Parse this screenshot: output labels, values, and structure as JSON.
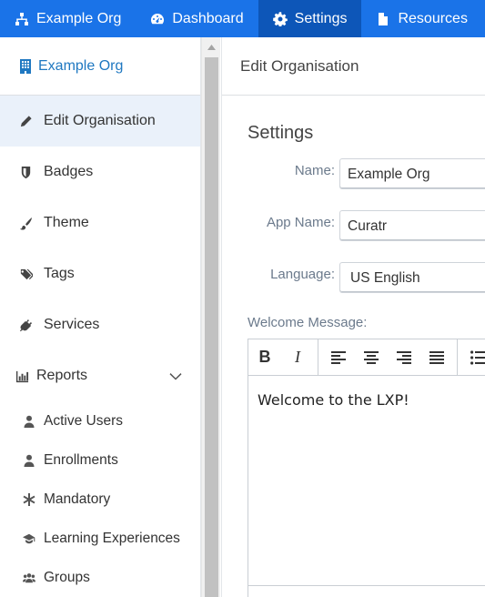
{
  "topnav": {
    "items": [
      {
        "label": "Example Org",
        "icon": "sitemap-icon",
        "active": false
      },
      {
        "label": "Dashboard",
        "icon": "dashboard-icon",
        "active": false
      },
      {
        "label": "Settings",
        "icon": "gear-icon",
        "active": true
      },
      {
        "label": "Resources",
        "icon": "document-icon",
        "active": false
      }
    ]
  },
  "sidebar": {
    "org_name": "Example Org",
    "items": [
      {
        "label": "Edit Organisation",
        "icon": "pencil-icon",
        "active": true
      },
      {
        "label": "Badges",
        "icon": "shield-icon"
      },
      {
        "label": "Theme",
        "icon": "brush-icon"
      },
      {
        "label": "Tags",
        "icon": "tags-icon"
      },
      {
        "label": "Services",
        "icon": "plug-icon"
      },
      {
        "label": "Reports",
        "icon": "bar-chart-icon",
        "expanded": true
      }
    ],
    "report_items": [
      {
        "label": "Active Users",
        "icon": "user-icon"
      },
      {
        "label": "Enrollments",
        "icon": "user-icon"
      },
      {
        "label": "Mandatory",
        "icon": "asterisk-icon"
      },
      {
        "label": "Learning Experiences",
        "icon": "graduation-cap-icon"
      },
      {
        "label": "Groups",
        "icon": "users-icon"
      }
    ]
  },
  "main": {
    "header": "Edit Organisation",
    "section_title": "Settings",
    "fields": {
      "name": {
        "label": "Name:",
        "value": "Example Org"
      },
      "app_name": {
        "label": "App Name:",
        "value": "Curatr"
      },
      "language": {
        "label": "Language:",
        "value": "US English"
      }
    },
    "welcome_label": "Welcome Message:",
    "welcome_text": "Welcome to the LXP!",
    "toolbar": {
      "bold": "B",
      "italic": "I"
    }
  },
  "colors": {
    "nav_bg": "#1a73e8",
    "nav_active": "#0d56b8",
    "link": "#1f78c1"
  }
}
